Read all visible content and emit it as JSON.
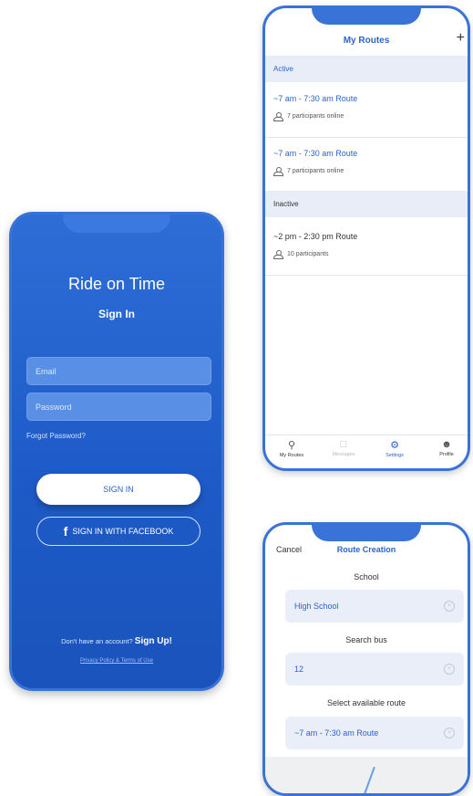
{
  "signin": {
    "app_title": "Ride on Time",
    "heading": "Sign In",
    "email_placeholder": "Email",
    "password_placeholder": "Password",
    "forgot": "Forgot Password?",
    "signin_button": "SIGN IN",
    "facebook_button": "SIGN IN WITH FACEBOOK",
    "no_account_text": "Don't have an account?",
    "signup_link": "Sign Up!",
    "policy": "Privacy Policy & Terms of Use"
  },
  "routes": {
    "title": "My Routes",
    "add_icon": "+",
    "active_section": "Active",
    "inactive_section": "Inactive",
    "active": [
      {
        "title": "~7 am - 7:30 am Route",
        "subtitle": "7 participants online"
      },
      {
        "title": "~7 am - 7:30 am Route",
        "subtitle": "7 participants online"
      }
    ],
    "inactive": [
      {
        "title": "~2 pm - 2:30 pm Route",
        "subtitle": "10 participants"
      }
    ],
    "tabs": [
      {
        "label": "My Routes",
        "icon": "map-pin-icon"
      },
      {
        "label": "Messages",
        "icon": "chat-icon"
      },
      {
        "label": "Settings",
        "icon": "gear-icon"
      },
      {
        "label": "Profile",
        "icon": "user-icon"
      }
    ]
  },
  "creation": {
    "cancel": "Cancel",
    "title": "Route Creation",
    "school_label": "School",
    "school_value": "High School",
    "bus_label": "Search bus",
    "bus_value": "12",
    "route_label": "Select available route",
    "route_value": "~7 am - 7:30 am Route"
  },
  "colors": {
    "brand_blue": "#1e5bc8",
    "accent_blue": "#2c64c8",
    "section_bg": "#e8edf7"
  }
}
